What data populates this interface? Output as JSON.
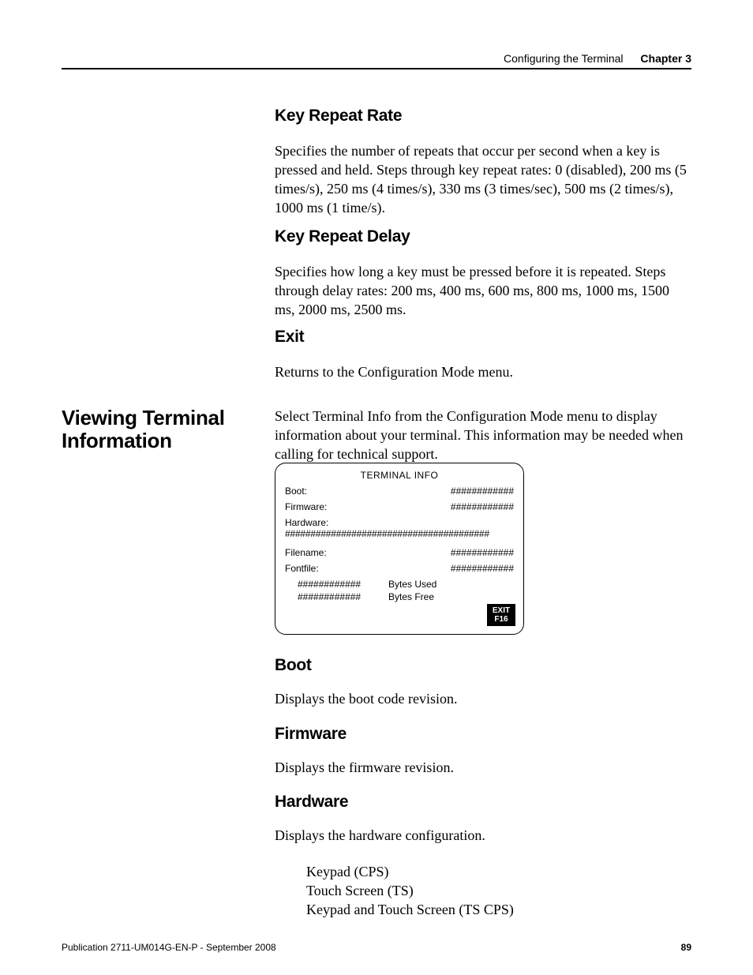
{
  "header": {
    "section_title": "Configuring the Terminal",
    "chapter_label": "Chapter 3"
  },
  "sidebar": {
    "heading": "Viewing Terminal Information"
  },
  "sections": {
    "key_repeat_rate": {
      "heading": "Key Repeat Rate",
      "body": "Specifies the number of repeats that occur per second when a key is pressed and held. Steps through key repeat rates: 0 (disabled), 200 ms (5 times/s), 250 ms (4 times/s), 330 ms (3 times/sec), 500 ms (2 times/s), 1000 ms (1 time/s)."
    },
    "key_repeat_delay": {
      "heading": "Key Repeat Delay",
      "body": "Specifies how long a key must be pressed before it is repeated. Steps through delay rates: 200 ms, 400 ms, 600 ms, 800 ms, 1000 ms, 1500 ms, 2000 ms, 2500 ms."
    },
    "exit": {
      "heading": "Exit",
      "body": "Returns to the Configuration Mode menu."
    },
    "intro": {
      "body": "Select Terminal Info from the Configuration Mode menu to display information about your terminal. This information may be needed when calling for technical support."
    },
    "boot": {
      "heading": "Boot",
      "body": "Displays the boot code revision."
    },
    "firmware": {
      "heading": "Firmware",
      "body": "Displays the firmware revision."
    },
    "hardware": {
      "heading": "Hardware",
      "body": "Displays the hardware configuration.",
      "items": [
        "Keypad (CPS)",
        "Touch Screen (TS)",
        "Keypad and Touch Screen (TS CPS)"
      ]
    }
  },
  "terminal_box": {
    "title": "TERMINAL INFO",
    "rows": {
      "boot_label": "Boot:",
      "boot_value": "############",
      "firmware_label": "Firmware:",
      "firmware_value": "############",
      "hardware_label": "Hardware:",
      "hardware_hashes": "########################################",
      "filename_label": "Filename:",
      "filename_value": "############",
      "fontfile_label": "Fontfile:",
      "fontfile_value": "############",
      "bytes_used_hash": "############",
      "bytes_used_label": "Bytes Used",
      "bytes_free_hash": "############",
      "bytes_free_label": "Bytes Free"
    },
    "exit_button": {
      "line1": "EXIT",
      "line2": "F16"
    }
  },
  "footer": {
    "pub": "Publication 2711-UM014G-EN-P - September 2008",
    "page": "89"
  }
}
